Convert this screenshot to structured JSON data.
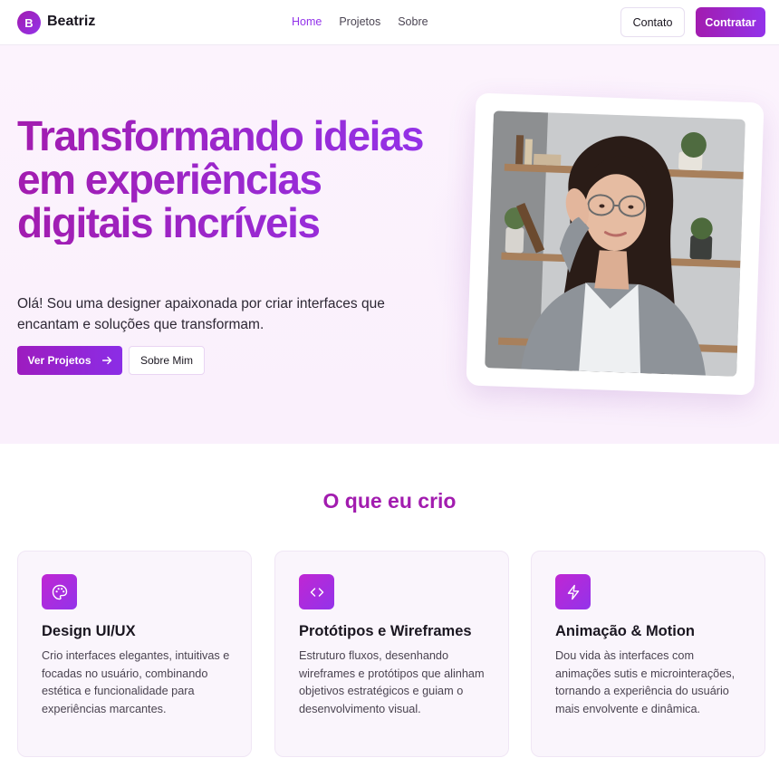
{
  "nav": {
    "logo_letter": "B",
    "brand": "Beatriz",
    "links": [
      "Home",
      "Projetos",
      "Sobre"
    ],
    "contato": "Contato",
    "contratar": "Contratar"
  },
  "hero": {
    "title": "Transformando ideias em experiências digitais incríveis",
    "subtitle": "Olá! Sou uma designer apaixonada por criar interfaces que encantam e soluções que transformam.",
    "primary_button": "Ver Projetos",
    "secondary_button": "Sobre Mim"
  },
  "services": {
    "heading": "O que eu crio",
    "cards": [
      {
        "icon": "palette-icon",
        "title": "Design UI/UX",
        "description": "Crio interfaces elegantes, intuitivas e focadas no usuário, combinando estética e funcionalidade para experiências marcantes."
      },
      {
        "icon": "code-icon",
        "title": "Protótipos e Wireframes",
        "description": "Estruturo fluxos, desenhando wireframes e protótipos que alinham objetivos estratégicos e guiam o desenvolvimento visual."
      },
      {
        "icon": "lightning-icon",
        "title": "Animação & Motion",
        "description": "Dou vida às interfaces com animações sutis e microinterações, tornando a experiência do usuário mais envolvente e dinâmica."
      }
    ]
  },
  "colors": {
    "accent": "#9333ea",
    "accent_alt": "#a21caf"
  }
}
